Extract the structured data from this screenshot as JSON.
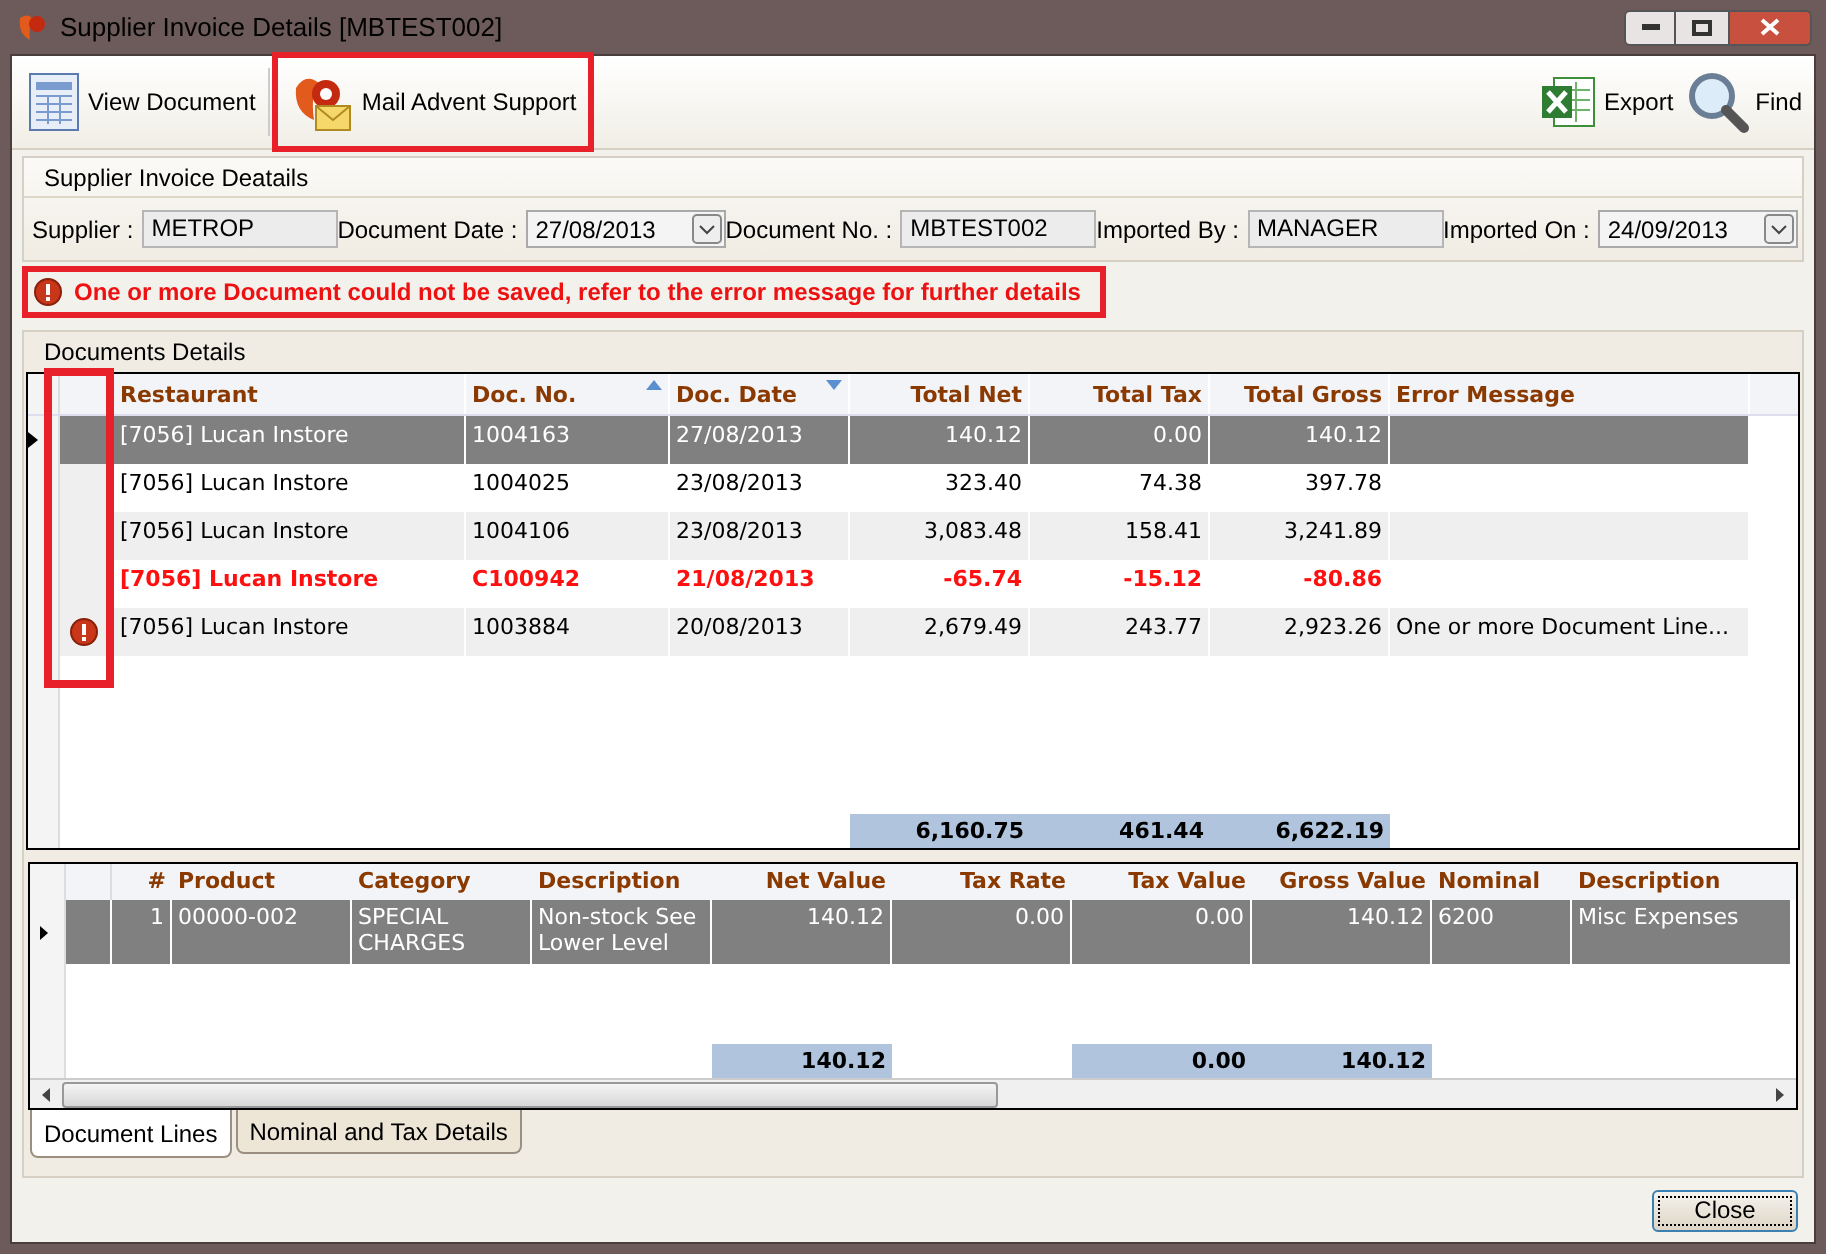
{
  "window": {
    "title": "Supplier Invoice Details [MBTEST002]"
  },
  "toolbar": {
    "left": [
      {
        "kind": "document",
        "label": "View Document",
        "highlighted": false
      },
      {
        "kind": "mail",
        "label": "Mail Advent Support",
        "highlighted": true
      }
    ],
    "right": [
      {
        "kind": "excel",
        "label": "Export"
      },
      {
        "kind": "find",
        "label": "Find"
      }
    ]
  },
  "header": {
    "title": "Supplier Invoice Deatails",
    "fields": [
      {
        "label": "Supplier :",
        "value": "METROP",
        "dropdown": false
      },
      {
        "label": "Document Date :",
        "value": "27/08/2013",
        "dropdown": true
      },
      {
        "label": "Document No. :",
        "value": "MBTEST002",
        "dropdown": false
      },
      {
        "label": "Imported By :",
        "value": "MANAGER",
        "dropdown": false
      },
      {
        "label": "Imported On :",
        "value": "24/09/2013",
        "dropdown": true
      }
    ],
    "error": {
      "text": "One or more Document could not be saved, refer to the error message for further details",
      "highlighted": true
    }
  },
  "documents": {
    "title": "Documents Details",
    "icon_column_highlighted": true,
    "columns": [
      {
        "label": "Restaurant"
      },
      {
        "label": "Doc. No.",
        "sorted_ascending": true
      },
      {
        "label": "Doc. Date",
        "sorted_descending": true
      },
      {
        "label": "Total Net",
        "total": "6,160.75"
      },
      {
        "label": "Total Tax",
        "total": "461.44"
      },
      {
        "label": "Total Gross",
        "total": "6,622.19"
      },
      {
        "label": "Error Message"
      }
    ],
    "rows": [
      {
        "selected": true,
        "kind": "normal",
        "error_icon": false,
        "cells": [
          "[7056] Lucan Instore",
          "1004163",
          "27/08/2013",
          "140.12",
          "0.00",
          "140.12"
        ]
      },
      {
        "selected": false,
        "kind": "normal",
        "error_icon": false,
        "cells": [
          "[7056] Lucan Instore",
          "1004025",
          "23/08/2013",
          "323.40",
          "74.38",
          "397.78"
        ]
      },
      {
        "selected": false,
        "kind": "normal",
        "error_icon": false,
        "cells": [
          "[7056] Lucan Instore",
          "1004106",
          "23/08/2013",
          "3,083.48",
          "158.41",
          "3,241.89"
        ]
      },
      {
        "selected": false,
        "kind": "credit",
        "error_icon": false,
        "cells": [
          "[7056] Lucan Instore",
          "C100942",
          "21/08/2013",
          "-65.74",
          "-15.12",
          "-80.86"
        ]
      },
      {
        "selected": false,
        "kind": "normal",
        "error_icon": true,
        "cells": [
          "[7056] Lucan Instore",
          "1003884",
          "20/08/2013",
          "2,679.49",
          "243.77",
          "2,923.26",
          "One or more Document Line..."
        ]
      }
    ]
  },
  "lines": {
    "columns": [
      {
        "label": "#"
      },
      {
        "label": "Product"
      },
      {
        "label": "Category"
      },
      {
        "label": "Description"
      },
      {
        "label": "Net Value",
        "total": "140.12"
      },
      {
        "label": "Tax Rate"
      },
      {
        "label": "Tax Value",
        "total": "0.00"
      },
      {
        "label": "Gross Value",
        "total": "140.12"
      },
      {
        "label": "Nominal"
      },
      {
        "label": "Description"
      }
    ],
    "rows": [
      {
        "selected": true,
        "cells": [
          "1",
          "00000-002",
          "SPECIAL CHARGES",
          "Non-stock See Lower Level",
          "140.12",
          "0.00",
          "0.00",
          "140.12",
          "6200",
          "Misc Expenses"
        ]
      }
    ]
  },
  "tabs": [
    {
      "label": "Document Lines",
      "selected": true
    },
    {
      "label": "Nominal and Tax Details",
      "selected": false
    }
  ],
  "buttons": [
    {
      "label": "Close"
    }
  ]
}
